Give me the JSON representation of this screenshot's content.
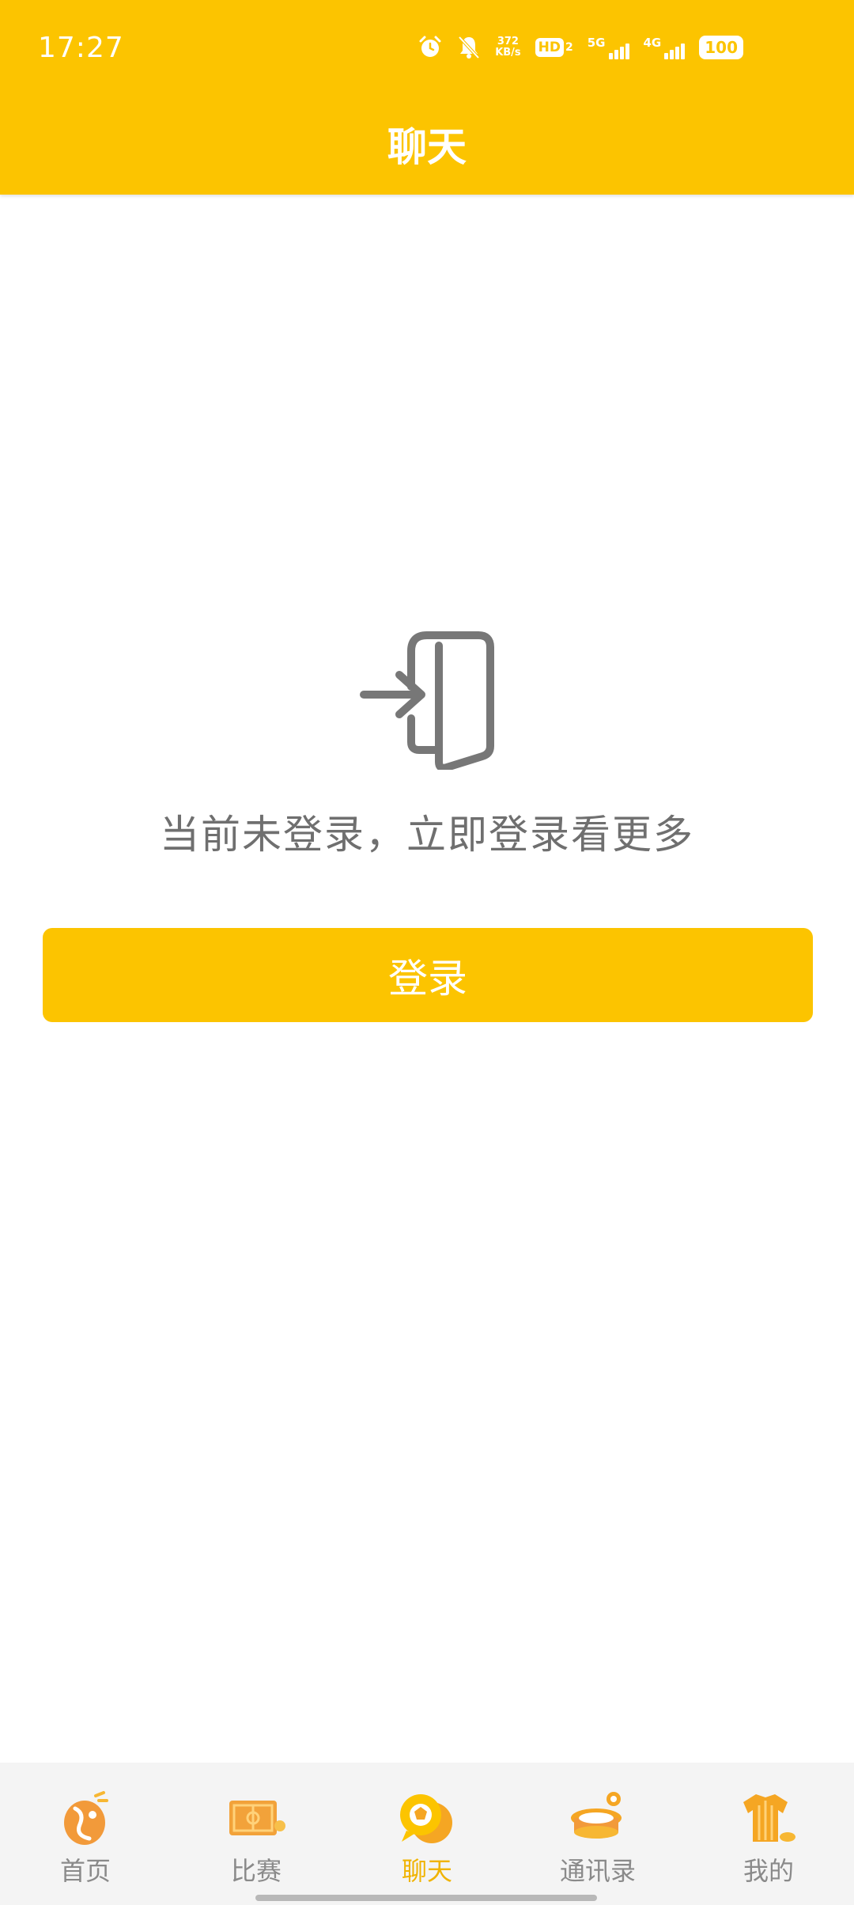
{
  "status_bar": {
    "time": "17:27",
    "net_speed_value": "372",
    "net_speed_unit": "KB/s",
    "hd_label": "HD",
    "hd_sub": "2",
    "signal1_label": "5G",
    "signal2_label": "4G",
    "battery": "100"
  },
  "header": {
    "title": "聊天"
  },
  "main": {
    "prompt": "当前未登录，立即登录看更多",
    "login_button_label": "登录"
  },
  "bottom_nav": {
    "items": [
      {
        "label": "首页",
        "icon": "home-icon",
        "active": false
      },
      {
        "label": "比赛",
        "icon": "match-field-icon",
        "active": false
      },
      {
        "label": "聊天",
        "icon": "chat-icon",
        "active": true
      },
      {
        "label": "通讯录",
        "icon": "contacts-stadium-icon",
        "active": false
      },
      {
        "label": "我的",
        "icon": "jersey-icon",
        "active": false
      }
    ]
  },
  "colors": {
    "accent": "#fcc400",
    "active_label": "#f0b300",
    "text_secondary": "#6f6f6f",
    "nav_background": "#f4f4f4"
  }
}
